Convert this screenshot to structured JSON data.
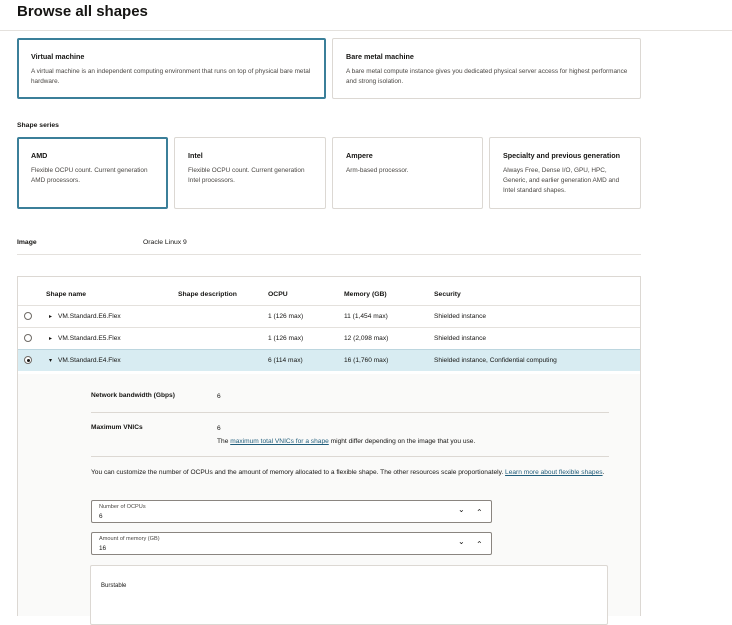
{
  "page": {
    "title": "Browse all shapes"
  },
  "instance_types": [
    {
      "title": "Virtual machine",
      "desc": "A virtual machine is an independent computing environment that runs on top of physical bare metal hardware.",
      "selected": true
    },
    {
      "title": "Bare metal machine",
      "desc": "A bare metal compute instance gives you dedicated physical server access for highest performance and strong isolation.",
      "selected": false
    }
  ],
  "shape_series": {
    "label": "Shape series",
    "items": [
      {
        "title": "AMD",
        "desc": "Flexible OCPU count. Current generation AMD processors.",
        "selected": true
      },
      {
        "title": "Intel",
        "desc": "Flexible OCPU count. Current generation Intel processors.",
        "selected": false
      },
      {
        "title": "Ampere",
        "desc": "Arm-based processor.",
        "selected": false
      },
      {
        "title": "Specialty and previous generation",
        "desc": "Always Free, Dense I/O, GPU, HPC, Generic, and earlier generation AMD and Intel standard shapes.",
        "selected": false
      }
    ]
  },
  "image": {
    "label": "Image",
    "value": "Oracle Linux 9"
  },
  "table": {
    "headers": [
      "Shape name",
      "Shape description",
      "OCPU",
      "Memory (GB)",
      "Security"
    ],
    "rows": [
      {
        "name": "VM.Standard.E6.Flex",
        "ocpu": "1 (126 max)",
        "memory": "11 (1,454 max)",
        "security": "Shielded instance",
        "selected": false,
        "expanded": false
      },
      {
        "name": "VM.Standard.E5.Flex",
        "ocpu": "1 (126 max)",
        "memory": "12 (2,098 max)",
        "security": "Shielded instance",
        "selected": false,
        "expanded": false
      },
      {
        "name": "VM.Standard.E4.Flex",
        "ocpu": "6 (114 max)",
        "memory": "16 (1,760 max)",
        "security": "Shielded instance, Confidential computing",
        "selected": true,
        "expanded": true
      }
    ]
  },
  "detail": {
    "bandwidth_label": "Network bandwidth (Gbps)",
    "bandwidth_value": "6",
    "vnics_label": "Maximum VNICs",
    "vnics_value": "6",
    "vnics_note_prefix": "The ",
    "vnics_note_link": "maximum total VNICs for a shape",
    "vnics_note_suffix": " might differ depending on the image that you use.",
    "customize_text": "You can customize the number of OCPUs and the amount of memory allocated to a flexible shape. The other resources scale proportionately. ",
    "customize_link": "Learn more about flexible shapes",
    "customize_end": ".",
    "ocpu_field": {
      "label": "Number of OCPUs",
      "value": "6"
    },
    "memory_field": {
      "label": "Amount of memory (GB)",
      "value": "16"
    },
    "burstable_label": "Burstable",
    "chevron_down": "⌄",
    "chevron_up": "⌃"
  },
  "icons": {
    "caret_right": "▸",
    "caret_down": "▾"
  },
  "colors": {
    "accent": "#3b7f99",
    "selected_row": "#d8ecf2",
    "link": "#1f5c7a"
  }
}
